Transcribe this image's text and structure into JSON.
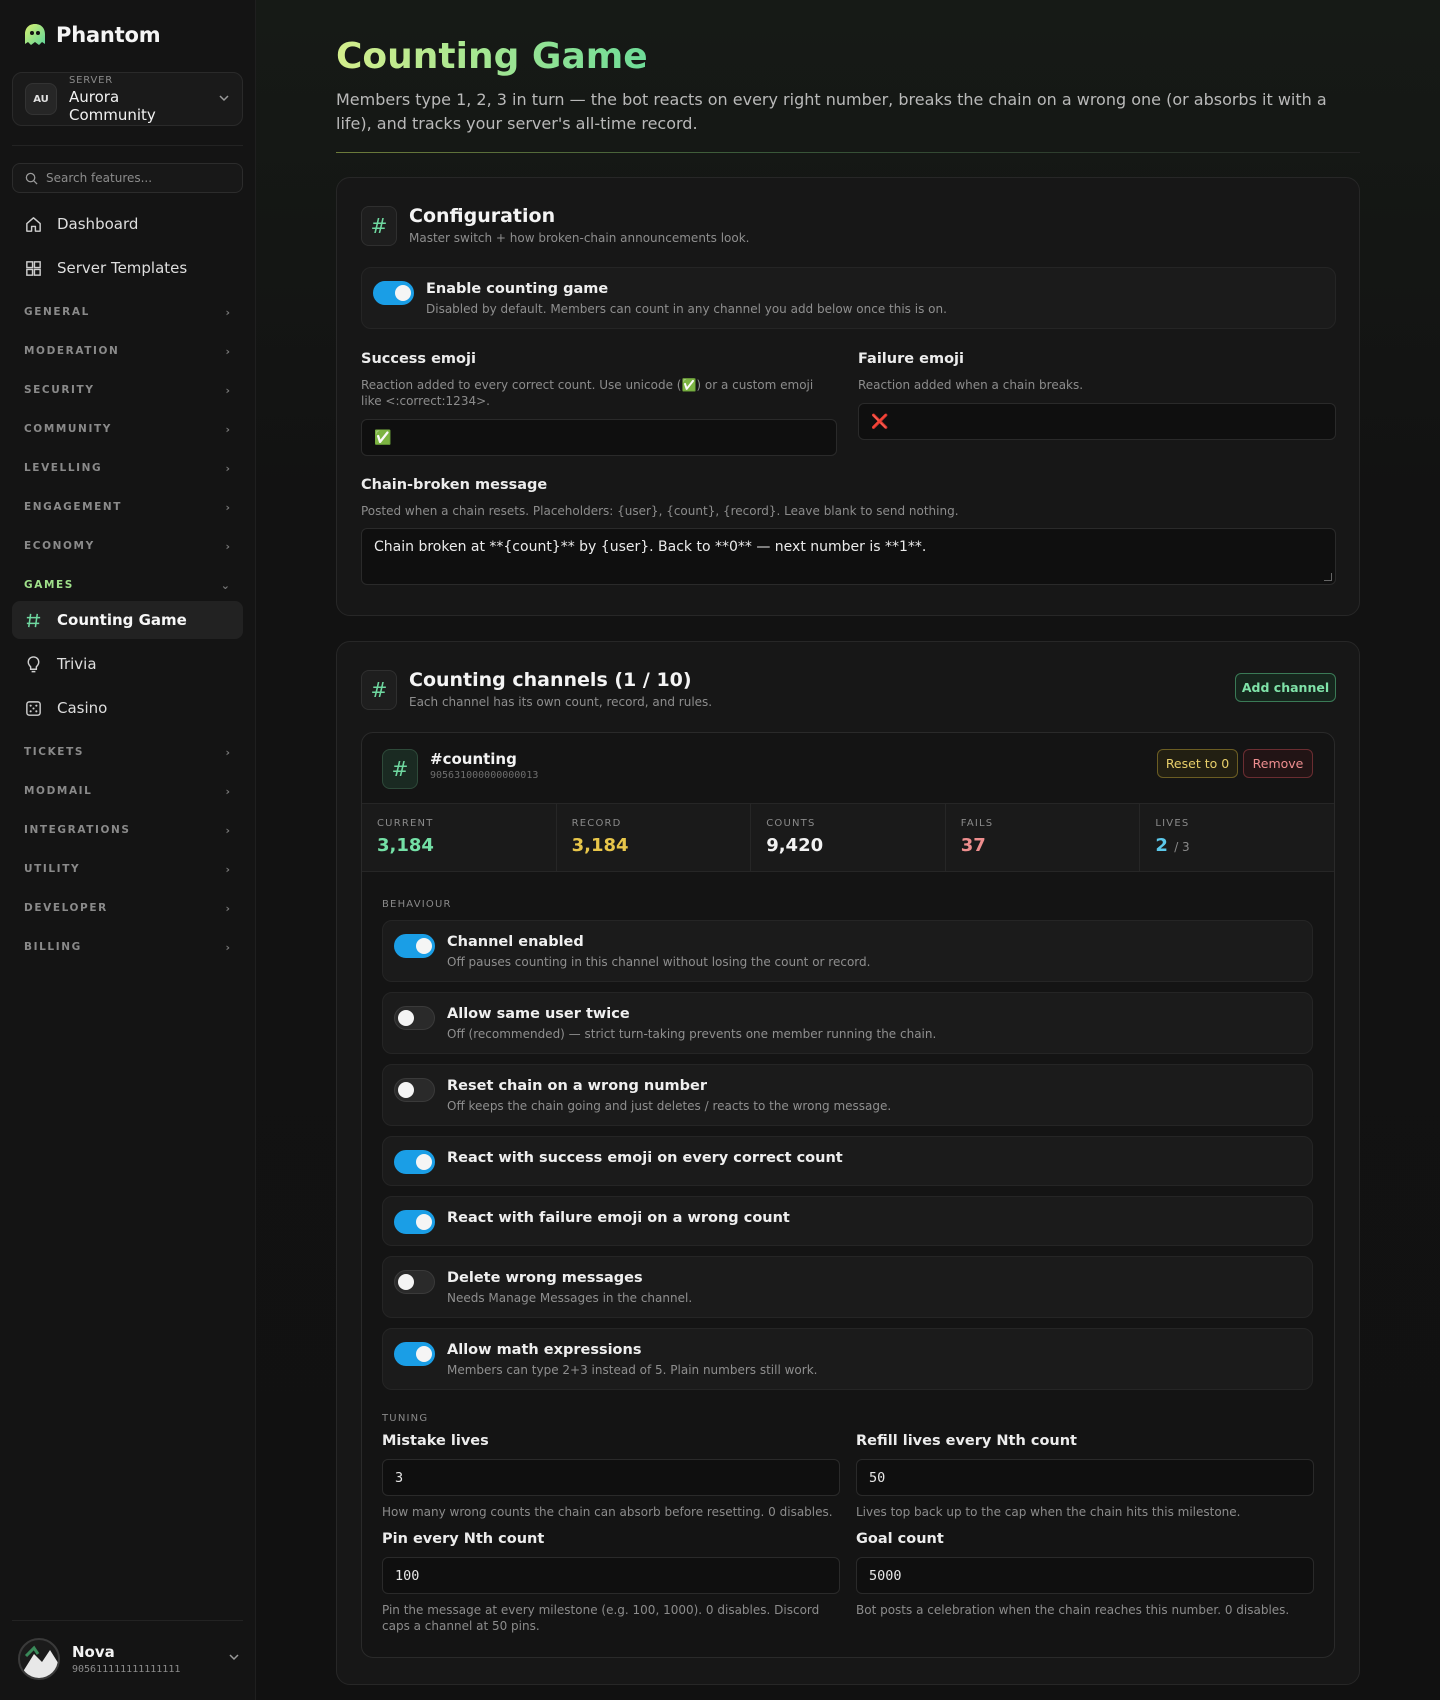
{
  "brand": {
    "name": "Phantom"
  },
  "server": {
    "label": "SERVER",
    "name": "Aurora Community",
    "avatar": "AU"
  },
  "search": {
    "placeholder": "Search features..."
  },
  "nav": {
    "top": [
      {
        "label": "Dashboard",
        "icon": "home-icon"
      },
      {
        "label": "Server Templates",
        "icon": "grid-icon"
      }
    ],
    "sections": [
      "GENERAL",
      "MODERATION",
      "SECURITY",
      "COMMUNITY",
      "LEVELLING",
      "ENGAGEMENT",
      "ECONOMY",
      "GAMES",
      "TICKETS",
      "MODMAIL",
      "INTEGRATIONS",
      "UTILITY",
      "DEVELOPER",
      "BILLING"
    ],
    "games_items": [
      {
        "label": "Counting Game",
        "icon": "hash-icon",
        "active": true
      },
      {
        "label": "Trivia",
        "icon": "lightbulb-icon"
      },
      {
        "label": "Casino",
        "icon": "dice-icon"
      }
    ]
  },
  "user": {
    "name": "Nova",
    "id": "905611111111111111"
  },
  "page": {
    "title": "Counting Game",
    "description": "Members type 1, 2, 3 in turn — the bot reacts on every right number, breaks the chain on a wrong one (or absorbs it with a life), and tracks your server's all-time record."
  },
  "config": {
    "title": "Configuration",
    "subtitle": "Master switch + how broken-chain announcements look.",
    "enable": {
      "title": "Enable counting game",
      "desc": "Disabled by default. Members can count in any channel you add below once this is on.",
      "on": true
    },
    "success_emoji": {
      "label": "Success emoji",
      "help": "Reaction added to every correct count. Use unicode (✅) or a custom emoji like <:correct:1234>.",
      "value": "✅"
    },
    "failure_emoji": {
      "label": "Failure emoji",
      "help": "Reaction added when a chain breaks.",
      "value": "❌"
    },
    "broken_message": {
      "label": "Chain-broken message",
      "help": "Posted when a chain resets. Placeholders: {user}, {count}, {record}. Leave blank to send nothing.",
      "value": "Chain broken at **{count}** by {user}. Back to **0** — next number is **1**."
    }
  },
  "channels": {
    "title": "Counting channels (1 / 10)",
    "subtitle": "Each channel has its own count, record, and rules.",
    "add_label": "Add channel",
    "channel": {
      "name": "#counting",
      "id": "905631000000000013",
      "reset_label": "Reset to 0",
      "remove_label": "Remove",
      "stats": [
        {
          "label": "CURRENT",
          "value": "3,184",
          "color": "#74e0a6"
        },
        {
          "label": "RECORD",
          "value": "3,184",
          "color": "#e8c64a"
        },
        {
          "label": "COUNTS",
          "value": "9,420",
          "color": "#f2f2f2"
        },
        {
          "label": "FAILS",
          "value": "37",
          "color": "#ee8e8e"
        },
        {
          "label": "LIVES",
          "value": "2",
          "suffix": "/ 3",
          "color": "#5cc8ea"
        }
      ],
      "behaviour_caption": "BEHAVIOUR",
      "behaviours": [
        {
          "title": "Channel enabled",
          "desc": "Off pauses counting in this channel without losing the count or record.",
          "on": true
        },
        {
          "title": "Allow same user twice",
          "desc": "Off (recommended) — strict turn-taking prevents one member running the chain.",
          "on": false
        },
        {
          "title": "Reset chain on a wrong number",
          "desc": "Off keeps the chain going and just deletes / reacts to the wrong message.",
          "on": false
        },
        {
          "title": "React with success emoji on every correct count",
          "desc": "",
          "on": true
        },
        {
          "title": "React with failure emoji on a wrong count",
          "desc": "",
          "on": true
        },
        {
          "title": "Delete wrong messages",
          "desc": "Needs Manage Messages in the channel.",
          "on": false
        },
        {
          "title": "Allow math expressions",
          "desc": "Members can type 2+3 instead of 5. Plain numbers still work.",
          "on": true
        }
      ],
      "tuning_caption": "TUNING",
      "tuning": [
        {
          "label": "Mistake lives",
          "value": "3",
          "help": "How many wrong counts the chain can absorb before resetting. 0 disables."
        },
        {
          "label": "Refill lives every Nth count",
          "value": "50",
          "help": "Lives top back up to the cap when the chain hits this milestone."
        },
        {
          "label": "Pin every Nth count",
          "value": "100",
          "help": "Pin the message at every milestone (e.g. 100, 1000). 0 disables. Discord caps a channel at 50 pins."
        },
        {
          "label": "Goal count",
          "value": "5000",
          "help": "Bot posts a celebration when the chain reaches this number. 0 disables."
        }
      ]
    }
  }
}
